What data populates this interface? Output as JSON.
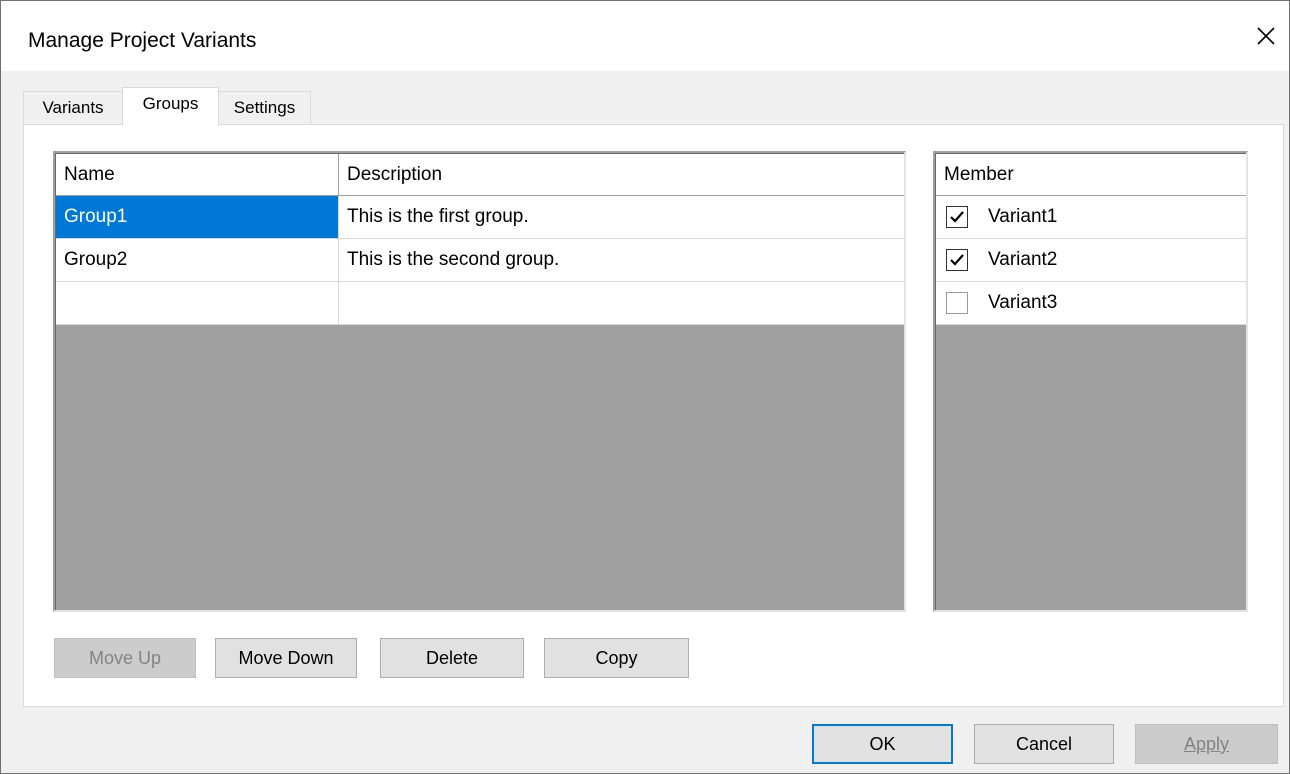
{
  "window": {
    "title": "Manage Project Variants",
    "close_icon": "close-icon"
  },
  "tabs": [
    {
      "label": "Variants",
      "active": false
    },
    {
      "label": "Groups",
      "active": true
    },
    {
      "label": "Settings",
      "active": false
    }
  ],
  "groups_grid": {
    "columns": [
      "Name",
      "Description"
    ],
    "rows": [
      {
        "name": "Group1",
        "description": "This is the first group.",
        "selected": true
      },
      {
        "name": "Group2",
        "description": "This is the second group.",
        "selected": false
      },
      {
        "name": "",
        "description": "",
        "selected": false
      }
    ]
  },
  "members_grid": {
    "column": "Member",
    "rows": [
      {
        "label": "Variant1",
        "checked": true
      },
      {
        "label": "Variant2",
        "checked": true
      },
      {
        "label": "Variant3",
        "checked": false
      }
    ]
  },
  "group_buttons": {
    "move_up": "Move Up",
    "move_down": "Move Down",
    "delete": "Delete",
    "copy": "Copy"
  },
  "dialog_buttons": {
    "ok": "OK",
    "cancel": "Cancel",
    "apply": "Apply"
  },
  "colors": {
    "selection": "#0078d7",
    "grid_background": "#a0a0a0",
    "disabled_text": "#838383"
  }
}
